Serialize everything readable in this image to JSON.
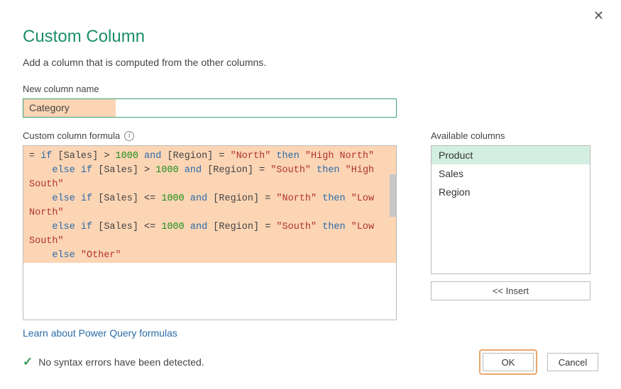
{
  "title": "Custom Column",
  "subtitle": "Add a column that is computed from the other columns.",
  "name_label": "New column name",
  "name_value": "Category",
  "formula_label": "Custom column formula",
  "available_label": "Available columns",
  "available_columns": [
    "Product",
    "Sales",
    "Region"
  ],
  "insert_label": "<< Insert",
  "learn_link": "Learn about Power Query formulas",
  "status_text": "No syntax errors have been detected.",
  "ok_label": "OK",
  "cancel_label": "Cancel",
  "formula": {
    "eq": "= ",
    "l1": {
      "kw1": "if",
      "c1": "[Sales]",
      "op1": " > ",
      "n1": "1000",
      "kw2": " and ",
      "c2": "[Region]",
      "op2": " = ",
      "s1": "\"North\"",
      "kw3": " then ",
      "s2": "\"High North\""
    },
    "l2": {
      "pre": "    ",
      "kw1": "else if",
      "c1": "[Sales]",
      "op1": " > ",
      "n1": "1000",
      "kw2": " and ",
      "c2": "[Region]",
      "op2": " = ",
      "s1": "\"South\"",
      "kw3": " then ",
      "s2": "\"High South\""
    },
    "l3": {
      "pre": "    ",
      "kw1": "else if",
      "c1": "[Sales]",
      "op1": " <= ",
      "n1": "1000",
      "kw2": " and ",
      "c2": "[Region]",
      "op2": " = ",
      "s1": "\"North\"",
      "kw3": " then ",
      "s2": "\"Low North\""
    },
    "l4": {
      "pre": "    ",
      "kw1": "else if",
      "c1": "[Sales]",
      "op1": " <= ",
      "n1": "1000",
      "kw2": " and ",
      "c2": "[Region]",
      "op2": " = ",
      "s1": "\"South\"",
      "kw3": " then ",
      "s2": "\"Low South\""
    },
    "l5": {
      "pre": "    ",
      "kw1": "else ",
      "s1": "\"Other\""
    }
  }
}
